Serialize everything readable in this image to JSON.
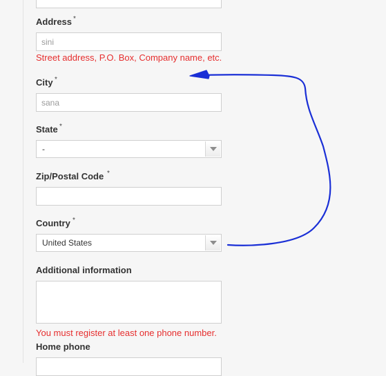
{
  "form": {
    "address": {
      "label": "Address",
      "required_mark": "*",
      "value": "sini",
      "hint": "Street address, P.O. Box, Company name, etc."
    },
    "city": {
      "label": "City",
      "required_mark": "*",
      "value": "sana"
    },
    "state": {
      "label": "State",
      "required_mark": "*",
      "selected": "-"
    },
    "zip": {
      "label": "Zip/Postal Code",
      "required_mark": "*",
      "value": ""
    },
    "country": {
      "label": "Country",
      "required_mark": "*",
      "selected": "United States"
    },
    "additional_info": {
      "label": "Additional information",
      "value": ""
    },
    "phone_error": "You must register at least one phone number.",
    "home_phone": {
      "label": "Home phone",
      "value": ""
    }
  },
  "colors": {
    "error": "#e62e2e",
    "annotation_ink": "#1a2fd6",
    "field_border": "#cfcfcf",
    "page_background": "#f6f6f6"
  },
  "icons": {
    "select_arrow": "chevron-down-icon",
    "annotation": "hand-drawn-arrow"
  }
}
